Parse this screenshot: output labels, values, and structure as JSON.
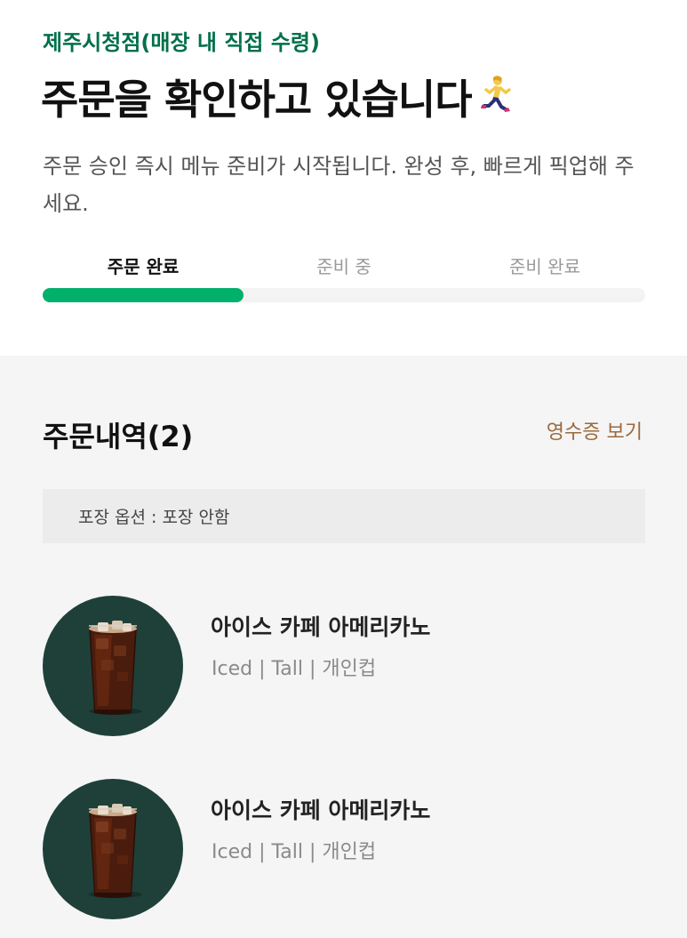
{
  "header": {
    "store_name": "제주시청점(매장 내 직접 수령)",
    "headline": "주문을 확인하고 있습니다",
    "subtext": "주문 승인 즉시 메뉴 준비가 시작됩니다. 완성 후, 빠르게 픽업해 주세요."
  },
  "progress": {
    "steps": [
      {
        "label": "주문 완료",
        "active": true
      },
      {
        "label": "준비 중",
        "active": false
      },
      {
        "label": "준비 완료",
        "active": false
      }
    ],
    "fraction_complete": 0.333
  },
  "order_history": {
    "title": "주문내역(2)",
    "receipt_link": "영수증 보기",
    "packaging_option": "포장 옵션 : 포장 안함",
    "items": [
      {
        "name": "아이스 카페 아메리카노",
        "option": "Iced | Tall | 개인컵",
        "image_icon": "iced-americano-image"
      },
      {
        "name": "아이스 카페 아메리카노",
        "option": "Iced | Tall | 개인컵",
        "image_icon": "iced-americano-image"
      }
    ]
  },
  "colors": {
    "brand_green": "#00704a",
    "progress_green": "#00b06b",
    "receipt_brown": "#9b6a3c",
    "thumb_bg": "#1f4039"
  }
}
